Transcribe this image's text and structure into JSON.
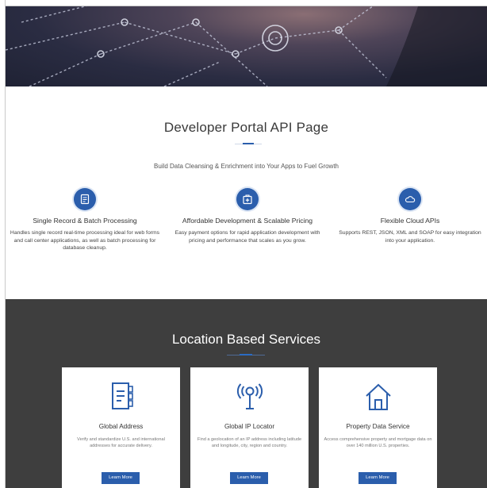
{
  "intro": {
    "title": "Developer Portal API Page",
    "subtitle": "Build Data Cleansing & Enrichment into Your Apps to Fuel Growth",
    "features": [
      {
        "icon": "document-icon",
        "title": "Single Record & Batch Processing",
        "description": "Handles single record real-time processing ideal for web forms and call center applications, as well as batch processing for database cleanup."
      },
      {
        "icon": "wallet-plus-icon",
        "title": "Affordable Development & Scalable Pricing",
        "description": "Easy payment options for rapid application development with pricing and performance that scales as you grow."
      },
      {
        "icon": "cloud-icon",
        "title": "Flexible Cloud APIs",
        "description": "Supports REST, JSON, XML and SOAP for easy integration into your application."
      }
    ]
  },
  "services": {
    "title": "Location Based Services",
    "cards": [
      {
        "icon": "address-book-icon",
        "title": "Global Address",
        "description": "Verify and standardize U.S. and international addresses for accurate delivery.",
        "button": "Learn More"
      },
      {
        "icon": "ip-locator-icon",
        "title": "Global IP Locator",
        "description": "Find a geolocation of an IP address including latitude and longitude, city, region and country.",
        "button": "Learn More"
      },
      {
        "icon": "house-icon",
        "title": "Property Data Service",
        "description": "Access comprehensive property and mortgage data on over 140 million U.S. properties.",
        "button": "Learn More"
      }
    ]
  },
  "colors": {
    "accent": "#2b5eac",
    "dark_section": "#3e3e3e"
  }
}
